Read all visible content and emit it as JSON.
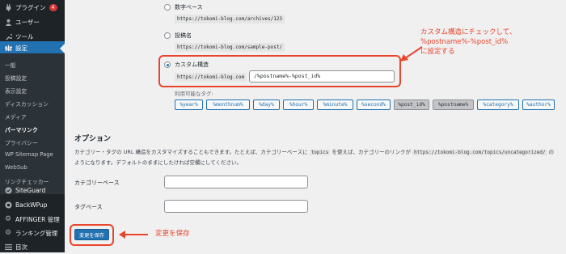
{
  "sidebar": {
    "top_items": [
      {
        "label": "プラグイン",
        "icon": "plugin-icon",
        "badge": "4"
      },
      {
        "label": "ユーザー",
        "icon": "user-icon"
      },
      {
        "label": "ツール",
        "icon": "wrench-icon"
      },
      {
        "label": "設定",
        "icon": "settings-icon",
        "active": true
      }
    ],
    "submenu": [
      "一般",
      "投稿設定",
      "表示設定",
      "ディスカッション",
      "メディア",
      "パーマリンク",
      "プライバシー",
      "WP Sitemap Page",
      "WebSub",
      "リンクチェッカー"
    ],
    "current_submenu": "パーマリンク",
    "bottom_items": [
      {
        "label": "SiteGuard",
        "icon": "siteguard-icon"
      },
      {
        "label": "BackWPup",
        "icon": "backwpup-icon"
      },
      {
        "label": "AFFINGER 管理",
        "icon": "affinger-gear-icon"
      },
      {
        "label": "ランキング管理",
        "icon": "ranking-gear-icon"
      },
      {
        "label": "目次",
        "icon": "toc-icon"
      }
    ]
  },
  "permalink": {
    "options": [
      {
        "label": "数字ベース",
        "example": "https://tokomi-blog.com/archives/123",
        "selected": false
      },
      {
        "label": "投稿名",
        "example": "https://tokomi-blog.com/sample-post/",
        "selected": false
      },
      {
        "label": "カスタム構造",
        "example": "https://tokomi-blog.com",
        "selected": true
      }
    ],
    "custom_value": "/%postname%-%post_id%",
    "available_tags_label": "利用可能なタグ:",
    "tags": [
      {
        "label": "%year%",
        "pressed": false
      },
      {
        "label": "%monthnum%",
        "pressed": false
      },
      {
        "label": "%day%",
        "pressed": false
      },
      {
        "label": "%hour%",
        "pressed": false
      },
      {
        "label": "%minute%",
        "pressed": false
      },
      {
        "label": "%second%",
        "pressed": false
      },
      {
        "label": "%post_id%",
        "pressed": true
      },
      {
        "label": "%postname%",
        "pressed": true
      },
      {
        "label": "%category%",
        "pressed": false
      },
      {
        "label": "%author%",
        "pressed": false
      }
    ]
  },
  "optional": {
    "heading": "オプション",
    "desc_a": "カテゴリー・タグの URL 構造をカスタマイズすることもできます。たとえば、カテゴリーベースに",
    "desc_code1": "topics",
    "desc_b": "を使えば、カテゴリーのリンクが",
    "desc_code2": "https://tokomi-blog.com/topics/uncategorized/",
    "desc_c": "の",
    "desc_line2": "ようになります。デフォルトのままにしたければ空欄にしてください。",
    "category_base_label": "カテゴリーベース",
    "category_base_value": "",
    "tag_base_label": "タグベース",
    "tag_base_value": ""
  },
  "save_label": "変更を保存",
  "annotations": {
    "custom_line1": "カスタム構造にチェックして、",
    "custom_line2": "%postname%-%post_id%",
    "custom_line3": "に設定する",
    "save": "変更を保存"
  },
  "colors": {
    "accent": "#2271b1",
    "annotation_red": "#e8452c",
    "sidebar_bg": "#1d2327"
  }
}
